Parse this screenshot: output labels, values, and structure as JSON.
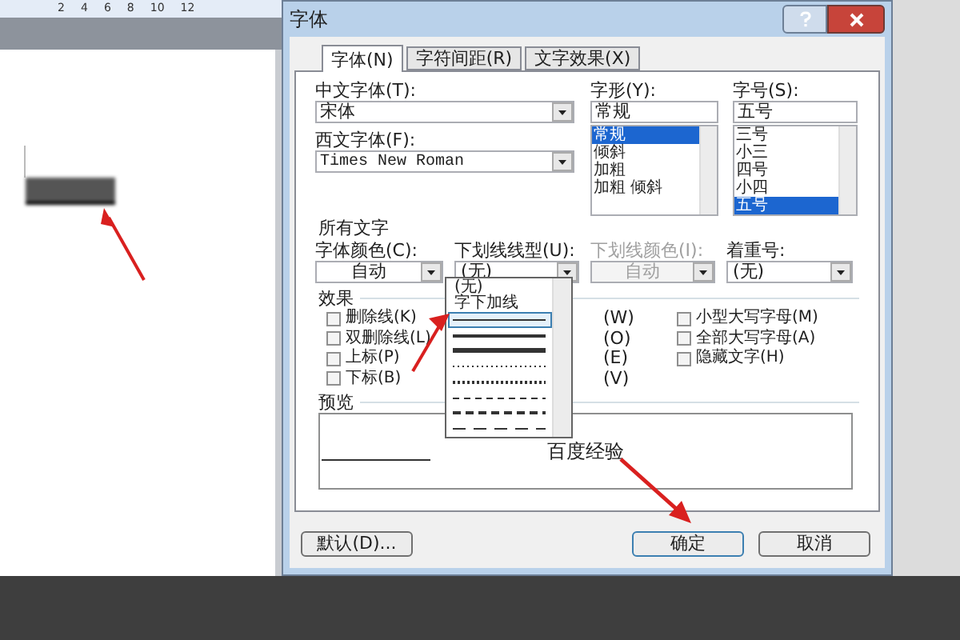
{
  "document": {
    "ruler_numbers": [
      "2",
      "4",
      "6",
      "8",
      "10",
      "12"
    ]
  },
  "dialog": {
    "title": "字体",
    "tabs": [
      {
        "label": "字体(N)",
        "selected": true
      },
      {
        "label": "字符间距(R)",
        "selected": false
      },
      {
        "label": "文字效果(X)",
        "selected": false
      }
    ],
    "chinese_font": {
      "label": "中文字体(T):",
      "value": "宋体"
    },
    "western_font": {
      "label": "西文字体(F):",
      "value": "Times New Roman"
    },
    "font_style": {
      "label": "字形(Y):",
      "value": "常规",
      "options": [
        {
          "label": "常规",
          "selected": true
        },
        {
          "label": "倾斜",
          "selected": false
        },
        {
          "label": "加粗",
          "selected": false
        },
        {
          "label": "加粗 倾斜",
          "selected": false
        }
      ]
    },
    "font_size": {
      "label": "字号(S):",
      "value": "五号",
      "options": [
        {
          "label": "三号",
          "selected": false
        },
        {
          "label": "小三",
          "selected": false
        },
        {
          "label": "四号",
          "selected": false
        },
        {
          "label": "小四",
          "selected": false
        },
        {
          "label": "五号",
          "selected": true
        }
      ]
    },
    "all_text": {
      "heading": "所有文字",
      "fields": [
        {
          "label": "字体颜色(C):",
          "value": "自动",
          "disabled": false
        },
        {
          "label": "下划线线型(U):",
          "value": "(无)",
          "disabled": false
        },
        {
          "label": "下划线颜色(I):",
          "value": "自动",
          "disabled": true
        },
        {
          "label": "着重号:",
          "value": "(无)",
          "disabled": false
        }
      ]
    },
    "effects": {
      "heading": "效果",
      "column_1": [
        {
          "label": "删除线(K)",
          "checked": false
        },
        {
          "label": "双删除线(L)",
          "checked": false
        },
        {
          "label": "上标(P)",
          "checked": false
        },
        {
          "label": "下标(B)",
          "checked": false
        }
      ],
      "column_2": [
        "(W)",
        "(O)",
        "(E)",
        "(V)"
      ],
      "column_3": [
        {
          "label": "小型大写字母(M)",
          "checked": false
        },
        {
          "label": "全部大写字母(A)",
          "checked": false
        },
        {
          "label": "隐藏文字(H)",
          "checked": false
        }
      ]
    },
    "underline_dropdown": [
      {
        "kind": "text",
        "label": "(无)",
        "selected": false
      },
      {
        "kind": "text",
        "label": "字下加线",
        "selected": false
      },
      {
        "kind": "line",
        "selected": true
      },
      {
        "kind": "line",
        "selected": false
      },
      {
        "kind": "line",
        "selected": false
      },
      {
        "kind": "line",
        "selected": false
      },
      {
        "kind": "line",
        "selected": false
      },
      {
        "kind": "line",
        "selected": false
      },
      {
        "kind": "line",
        "selected": false
      },
      {
        "kind": "line",
        "selected": false
      }
    ],
    "preview": {
      "heading": "预览",
      "text": "百度经验"
    },
    "buttons": [
      {
        "label": "默认(D)...",
        "default": false
      },
      {
        "label": "确定",
        "default": true
      },
      {
        "label": "取消",
        "default": false
      }
    ]
  }
}
